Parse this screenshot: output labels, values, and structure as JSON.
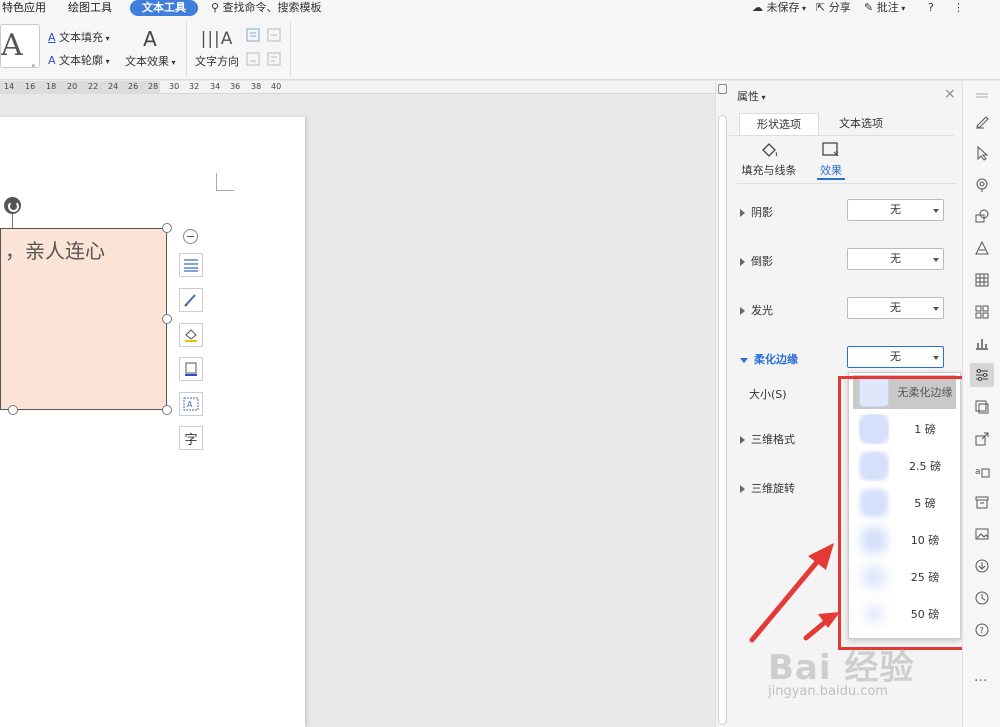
{
  "menubar": {
    "tabs": [
      "特色应用",
      "绘图工具",
      "文本工具"
    ],
    "search_text": "查找命令、搜索模板",
    "unsaved": "未保存",
    "share": "分享",
    "annotate": "批注",
    "help": "?",
    "more": "⋮"
  },
  "ribbon": {
    "big_a": "A",
    "text_fill": "文本填充",
    "text_outline": "文本轮廓",
    "text_effect": "文本效果",
    "text_direction": "文字方向"
  },
  "ruler": {
    "numbers": [
      "14",
      "16",
      "18",
      "20",
      "22",
      "24",
      "26",
      "28",
      "30",
      "32",
      "34",
      "36",
      "38",
      "40"
    ]
  },
  "canvas": {
    "shape_text": "，亲人连心"
  },
  "panel": {
    "title": "属性",
    "close": "×",
    "tabs": [
      "形状选项",
      "文本选项"
    ],
    "subtabs": [
      "填充与线条",
      "效果"
    ],
    "rows": [
      {
        "label": "阴影",
        "value": "无"
      },
      {
        "label": "倒影",
        "value": "无"
      },
      {
        "label": "发光",
        "value": "无"
      },
      {
        "label": "柔化边缘",
        "value": "无"
      }
    ],
    "size_label": "大小(S)",
    "rows_below": [
      "三维格式",
      "三维旋转"
    ]
  },
  "dropdown": {
    "items": [
      {
        "label": "无柔化边缘",
        "blur": 0
      },
      {
        "label": "1 磅",
        "blur": 1
      },
      {
        "label": "2.5 磅",
        "blur": 2.5
      },
      {
        "label": "5 磅",
        "blur": 5
      },
      {
        "label": "10 磅",
        "blur": 10
      },
      {
        "label": "25 磅",
        "blur": 25
      },
      {
        "label": "50 磅",
        "blur": 50
      }
    ],
    "selected_index": 0
  },
  "sidebar": {
    "more": "..."
  },
  "watermark": {
    "main": "Bai 经验",
    "sub": "jingyan.baidu.com"
  },
  "colors": {
    "accent": "#3f7fdb",
    "highlight": "#e53935",
    "shape_fill": "#fbe4d6"
  }
}
